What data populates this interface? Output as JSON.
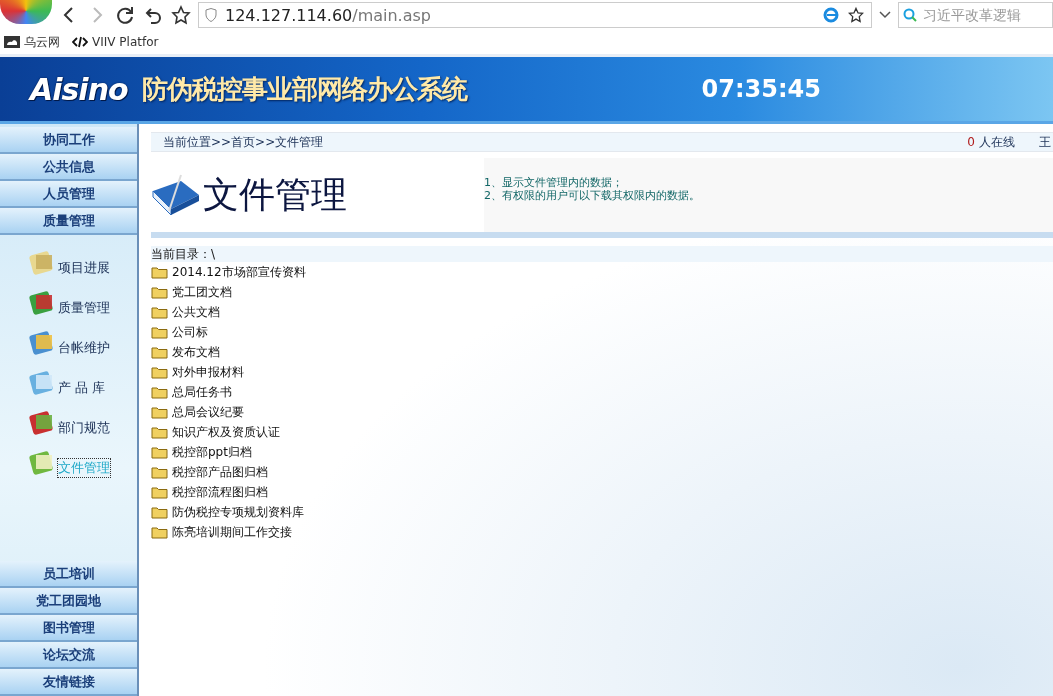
{
  "browser": {
    "url_host": "124.127.114.60",
    "url_path": "/main.asp",
    "search": {
      "placeholder": "习近平改革逻辑"
    },
    "bookmarks": [
      "乌云网",
      "VIIV Platfor"
    ]
  },
  "banner": {
    "logo": "Aisino",
    "title": "防伪税控事业部网络办公系统",
    "clock": "07:35:45"
  },
  "sidebar": {
    "top_menu": [
      "协同工作",
      "公共信息",
      "人员管理",
      "质量管理"
    ],
    "items": [
      {
        "label": "项目进展",
        "selected": false
      },
      {
        "label": "质量管理",
        "selected": false
      },
      {
        "label": "台帐维护",
        "selected": false
      },
      {
        "label": "产 品 库",
        "selected": false
      },
      {
        "label": "部门规范",
        "selected": false
      },
      {
        "label": "文件管理",
        "selected": true
      }
    ],
    "bottom_menu": [
      "员工培训",
      "党工团园地",
      "图书管理",
      "论坛交流",
      "友情链接"
    ]
  },
  "location": {
    "prefix": "当前位置>>首页>>",
    "current": "文件管理",
    "online_count": "0",
    "online_label": "人在线",
    "cut_text": "王"
  },
  "header": {
    "title": "文件管理",
    "notes": [
      "1、显示文件管理内的数据；",
      "2、有权限的用户可以下载其权限内的数据。"
    ]
  },
  "directory": {
    "label": "当前目录：\\",
    "folders": [
      "2014.12市场部宣传资料",
      "党工团文档",
      "公共文档",
      "公司标",
      "发布文档",
      "对外申报材料",
      "总局任务书",
      "总局会议纪要",
      "知识产权及资质认证",
      "税控部ppt归档",
      "税控部产品图归档",
      "税控部流程图归档",
      "防伪税控专项规划资料库",
      "陈亮培训期间工作交接"
    ]
  }
}
